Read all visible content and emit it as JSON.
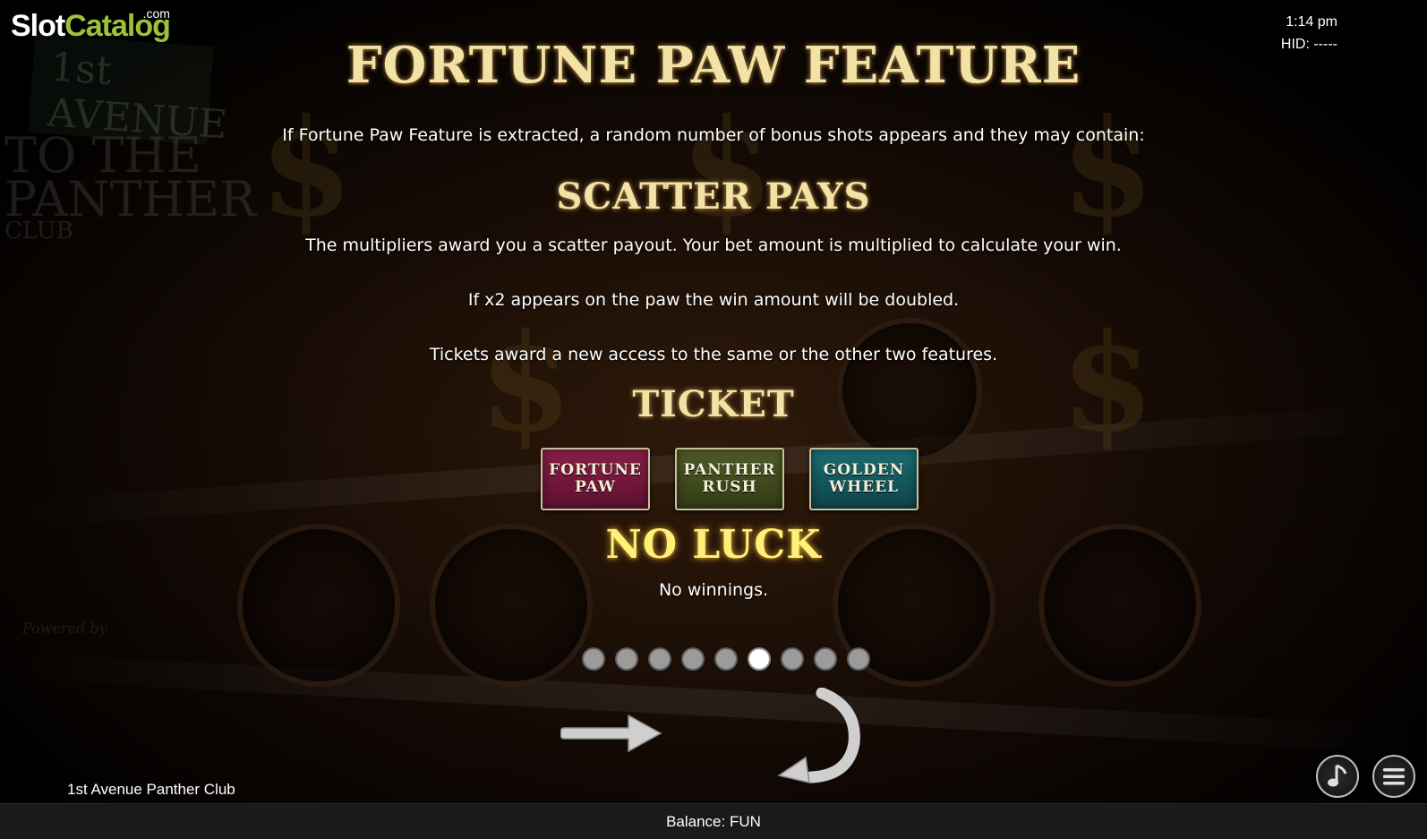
{
  "branding": {
    "logo_part1": "Slot",
    "logo_part2": "Catalog",
    "logo_suffix": ".com"
  },
  "status": {
    "time": "1:14 pm",
    "hid": "HID: -----"
  },
  "page": {
    "title": "FORTUNE PAW FEATURE",
    "intro": "If Fortune Paw Feature is extracted, a random number of bonus shots appears and they may contain:",
    "scatter_heading": "SCATTER PAYS",
    "scatter_text": "The multipliers award you a scatter payout. Your bet amount is multiplied to calculate your win.",
    "x2_text": "If x2 appears on the paw the win amount will be doubled.",
    "tickets_text": "Tickets award a new access to the same or the other two features.",
    "ticket_heading": "TICKET",
    "ticket_buttons": [
      {
        "label": "FORTUNE\nPAW",
        "color": "#7a1a40"
      },
      {
        "label": "PANTHER\nRUSH",
        "color": "#45521f"
      },
      {
        "label": "GOLDEN\nWHEEL",
        "color": "#145c63"
      }
    ],
    "noluck_heading": "NO LUCK",
    "noluck_text": "No winnings."
  },
  "pagination": {
    "total": 9,
    "active_index": 5
  },
  "footer": {
    "game_name": "1st Avenue Panther Club",
    "balance": "Balance: FUN"
  },
  "icons": {
    "next": "right-arrow-icon",
    "return": "return-arrow-icon",
    "music": "music-note-icon",
    "menu": "hamburger-menu-icon"
  },
  "colors": {
    "heading_gold": "#f3e2a6",
    "noluck_yellow": "#fff07a",
    "logo_green": "#9cc23c"
  }
}
